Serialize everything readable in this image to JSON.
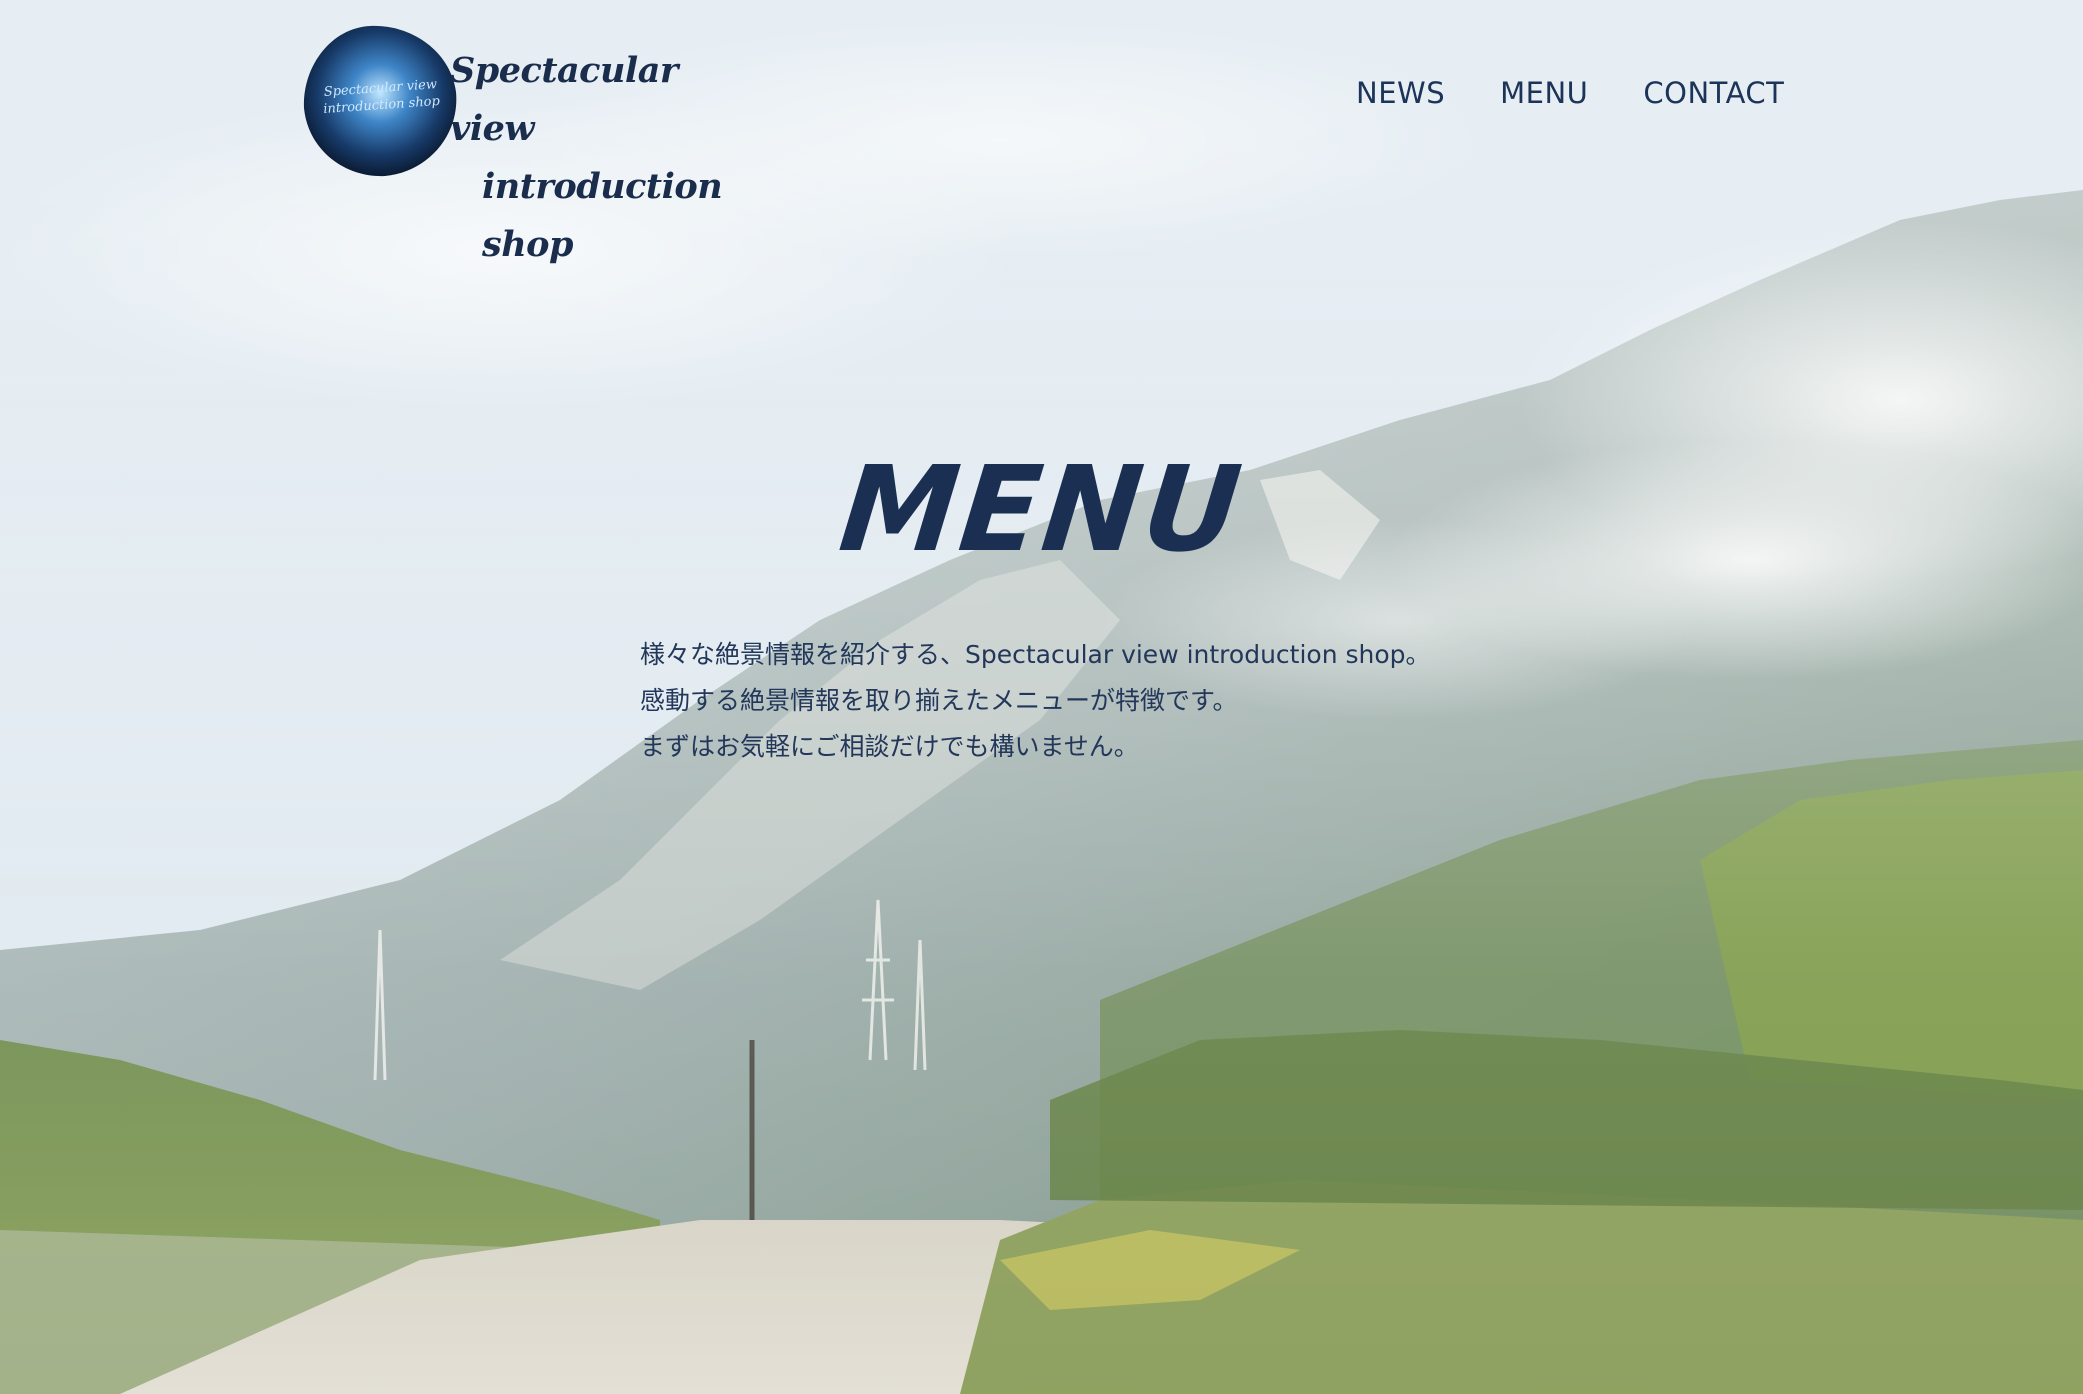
{
  "logo": {
    "line1": "Spectacular view",
    "line2": "introduction shop",
    "mark_line1": "Spectacular view",
    "mark_line2": "introduction shop"
  },
  "nav": {
    "items": [
      {
        "label": "NEWS"
      },
      {
        "label": "MENU"
      },
      {
        "label": "CONTACT"
      }
    ]
  },
  "hero": {
    "title": "MENU",
    "description": [
      "様々な絶景情報を紹介する、Spectacular view introduction shop。",
      "感動する絶景情報を取り揃えたメニューが特徴です。",
      "まずはお気軽にご相談だけでも構いません。"
    ]
  },
  "colors": {
    "text": "#1c3457",
    "sky": "#cfdde8",
    "mountain": "#8fa59a",
    "foliage": "#6f8a45"
  }
}
